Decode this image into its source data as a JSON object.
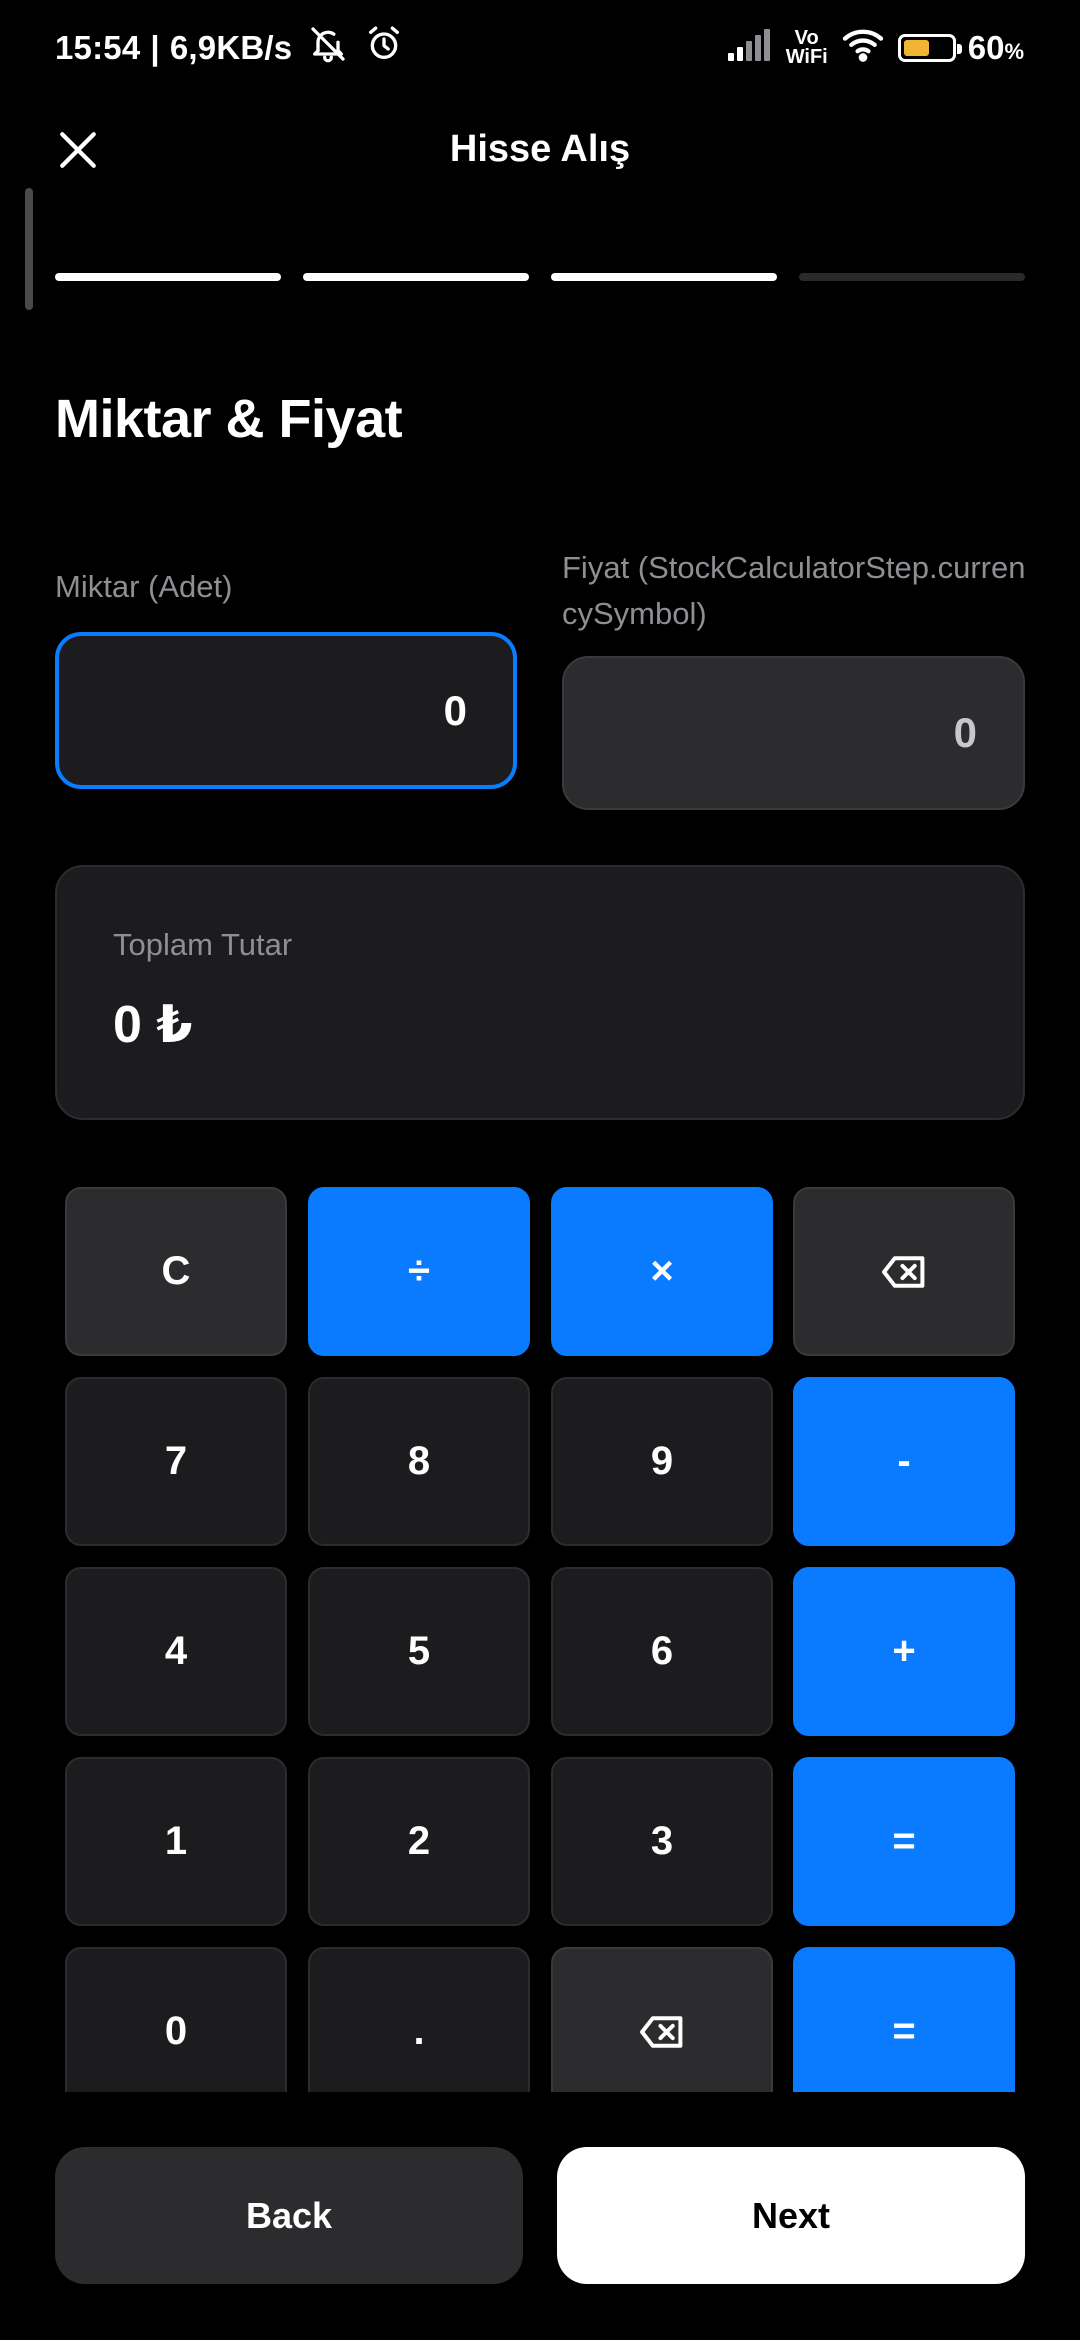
{
  "status_bar": {
    "time": "15:54",
    "separator": "|",
    "network_speed": "6,9KB/s",
    "icons_left": [
      "bell-off-icon",
      "alarm-icon"
    ],
    "icons_right": [
      "signal-icon",
      "vowifi-icon",
      "wifi-icon",
      "battery-icon"
    ],
    "vowifi_top": "Vo",
    "vowifi_bottom": "WiFi",
    "battery_level": 0.6,
    "battery_color": "#f2b232",
    "battery_percent": "60",
    "percent_sign": "%"
  },
  "header": {
    "close_icon": "close-icon",
    "title": "Hisse Alış"
  },
  "progress": {
    "total_steps": 4,
    "completed_steps": 3
  },
  "form": {
    "section_title": "Miktar & Fiyat",
    "quantity": {
      "label": "Miktar (Adet)",
      "value": "0"
    },
    "price": {
      "label": "Fiyat (StockCalculatorStep.currencySymbol)",
      "value": "0"
    },
    "total": {
      "label": "Toplam Tutar",
      "value": "0 ₺"
    }
  },
  "keypad": {
    "rows": [
      [
        "C",
        "÷",
        "×",
        "⌫"
      ],
      [
        "7",
        "8",
        "9",
        "-"
      ],
      [
        "4",
        "5",
        "6",
        "+"
      ],
      [
        "1",
        "2",
        "3",
        "="
      ],
      [
        "0",
        ".",
        "⌫",
        "="
      ]
    ],
    "backspace_icon": "backspace-icon"
  },
  "colors": {
    "accent": "#0a7aff",
    "background": "#000000",
    "surface": "#1c1c1e"
  },
  "footer": {
    "back_label": "Back",
    "next_label": "Next"
  }
}
